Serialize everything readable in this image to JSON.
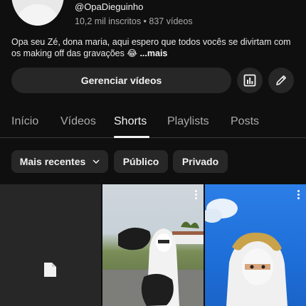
{
  "channel": {
    "handle": "@OpaDieguinho",
    "stats": "10,2 mil inscritos • 837 vídeos",
    "description": "Opa seu Zé, dona maria, aqui espero que todos vocês se divirtam com os making off das gravações 😂",
    "more_label": "...mais"
  },
  "actions": {
    "manage_label": "Gerenciar vídeos",
    "analytics_icon": "analytics-icon",
    "edit_icon": "pencil-icon"
  },
  "tabs": [
    {
      "label": "Início",
      "active": false
    },
    {
      "label": "Vídeos",
      "active": false
    },
    {
      "label": "Shorts",
      "active": true
    },
    {
      "label": "Playlists",
      "active": false
    },
    {
      "label": "Posts",
      "active": false
    }
  ],
  "filters": {
    "sort_label": "Mais recentes",
    "public_label": "Público",
    "private_label": "Privado"
  },
  "colors": {
    "background": "#0f0f0f",
    "surface": "#272727",
    "text": "#f1f1f1",
    "muted": "#aaaaaa"
  }
}
